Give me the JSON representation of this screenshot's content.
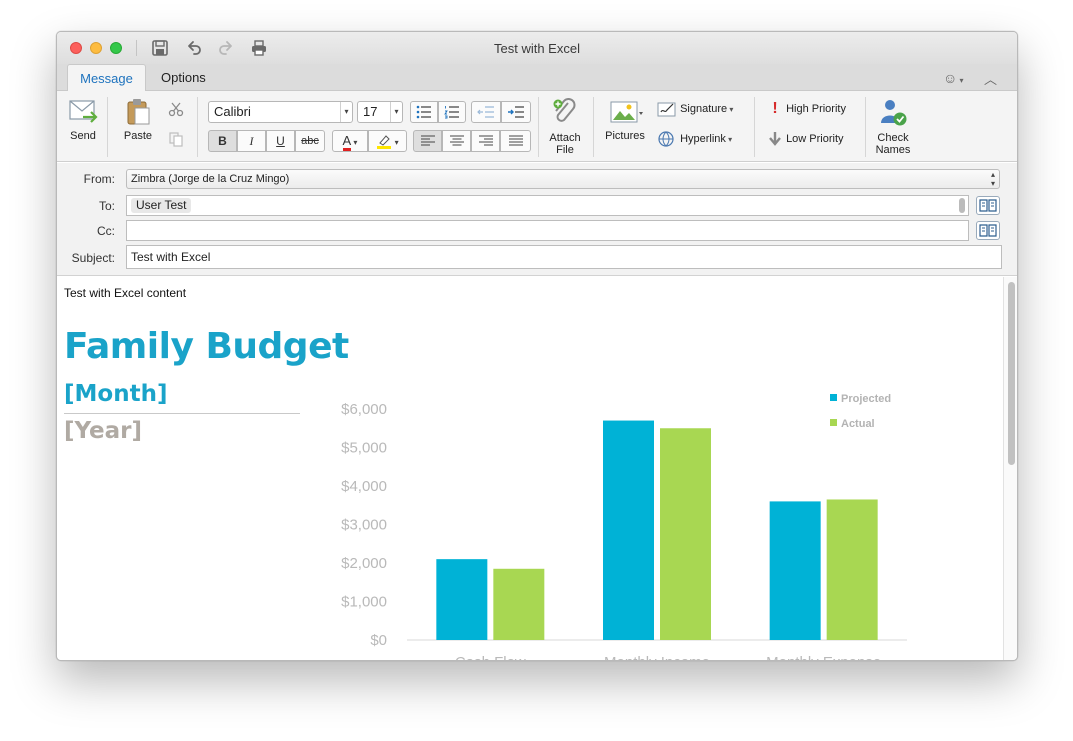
{
  "window": {
    "title": "Test with Excel"
  },
  "tabs": [
    {
      "label": "Message"
    },
    {
      "label": "Options"
    }
  ],
  "ribbon": {
    "send": "Send",
    "paste": "Paste",
    "font_name": "Calibri",
    "font_size": "17",
    "bold": "B",
    "italic": "I",
    "underline": "U",
    "strike": "abc",
    "font_color": "A",
    "attach": "Attach",
    "attach2": "File",
    "pictures": "Pictures",
    "signature": "Signature",
    "hyperlink": "Hyperlink",
    "high_priority": "High Priority",
    "low_priority": "Low Priority",
    "check": "Check",
    "check2": "Names"
  },
  "header": {
    "from_label": "From:",
    "from_value": "Zimbra (Jorge de la Cruz Mingo)",
    "to_label": "To:",
    "to_value": "User Test",
    "cc_label": "Cc:",
    "cc_value": "",
    "subject_label": "Subject:",
    "subject_value": "Test with Excel"
  },
  "body": {
    "intro": "Test with Excel content",
    "title": "Family Budget",
    "month": "[Month]",
    "year": "[Year]"
  },
  "colors": {
    "accent": "#1e73be",
    "projected": "#00b2d6",
    "actual": "#a8d752",
    "title": "#1aa3c9",
    "year": "#b0aaa3"
  },
  "chart_data": {
    "type": "bar",
    "categories": [
      "Cash Flow",
      "Monthly Income",
      "Monthly Expense"
    ],
    "series": [
      {
        "name": "Projected",
        "values": [
          2100,
          5700,
          3600
        ]
      },
      {
        "name": "Actual",
        "values": [
          1850,
          5500,
          3650
        ]
      }
    ],
    "yticks": [
      "$0",
      "$1,000",
      "$2,000",
      "$3,000",
      "$4,000",
      "$5,000",
      "$6,000"
    ],
    "ylim": [
      0,
      6000
    ],
    "legend": "top-right",
    "grid": false
  }
}
